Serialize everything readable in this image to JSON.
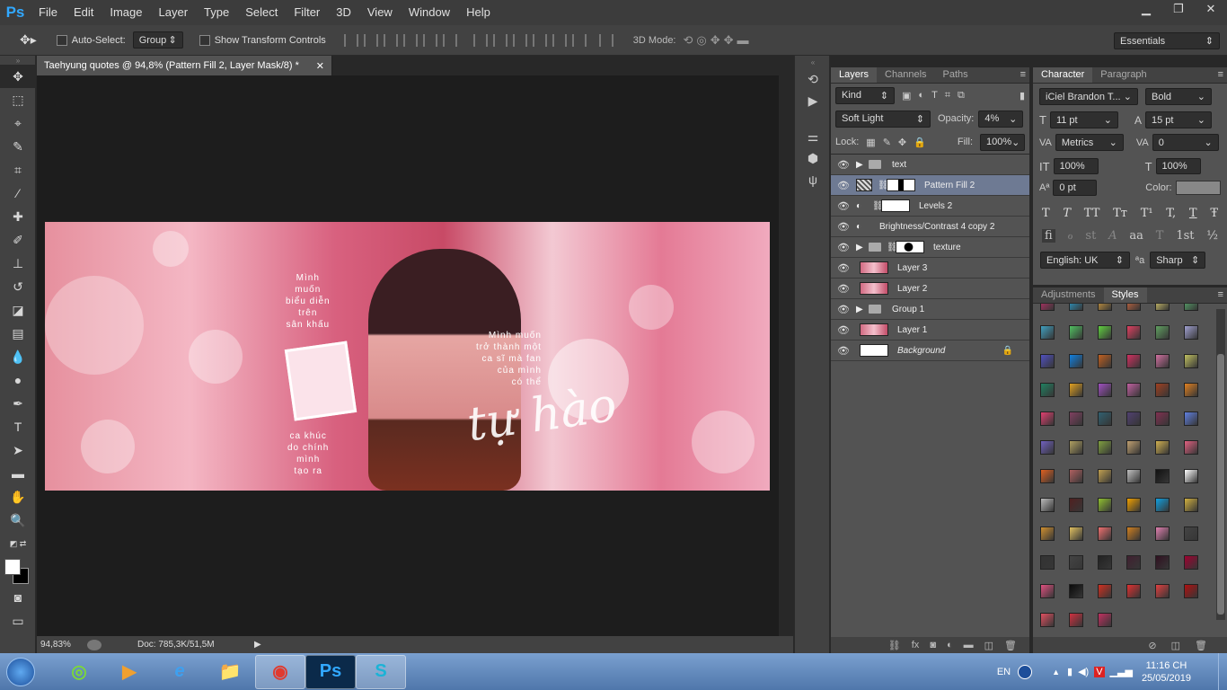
{
  "app": {
    "logo": "Ps"
  },
  "menu": [
    "File",
    "Edit",
    "Image",
    "Layer",
    "Type",
    "Select",
    "Filter",
    "3D",
    "View",
    "Window",
    "Help"
  ],
  "window_controls": {
    "minimize": "▁",
    "restore": "❐",
    "close": "✕"
  },
  "options": {
    "move_icon": "move-icon",
    "auto_select_label": "Auto-Select:",
    "auto_select_value": "Group",
    "show_transform_label": "Show Transform Controls",
    "mode_label": "3D Mode:",
    "workspace": "Essentials"
  },
  "document": {
    "tab_title": "Taehyung quotes @ 94,8% (Pattern Fill 2, Layer Mask/8) *",
    "close": "✕",
    "zoom": "94,83%",
    "doc_info": "Doc: 785,3K/51,5M"
  },
  "artwork": {
    "text_left_top": "Mình\nmuốn\nbiểu diễn\ntrên\nsân khấu",
    "text_left_bottom": "ca khúc\ndo chính\nmình\ntạo ra",
    "text_right": "Mình muốn\ntrở thành một\nca sĩ mà fan\ncủa mình\ncó thể",
    "script": "tự hào"
  },
  "layers_panel": {
    "tabs": [
      "Layers",
      "Channels",
      "Paths"
    ],
    "kind": "Kind",
    "blend": "Soft Light",
    "opacity_label": "Opacity:",
    "opacity": "4%",
    "lock_label": "Lock:",
    "fill_label": "Fill:",
    "fill": "100%",
    "layers": [
      {
        "name": "text",
        "type": "group"
      },
      {
        "name": "Pattern Fill 2",
        "type": "fill",
        "selected": true
      },
      {
        "name": "Levels 2",
        "type": "adjust"
      },
      {
        "name": "Brightness/Contrast 4 copy 2",
        "type": "adjust"
      },
      {
        "name": "texture",
        "type": "group"
      },
      {
        "name": "Layer 3",
        "type": "photo"
      },
      {
        "name": "Layer 2",
        "type": "photo"
      },
      {
        "name": "Group 1",
        "type": "group"
      },
      {
        "name": "Layer 1",
        "type": "photo"
      },
      {
        "name": "Background",
        "type": "background"
      }
    ]
  },
  "character_panel": {
    "tabs": [
      "Character",
      "Paragraph"
    ],
    "font": "iCiel Brandon T...",
    "style": "Bold",
    "size": "11 pt",
    "leading": "15 pt",
    "kerning": "Metrics",
    "tracking": "0",
    "vscale": "100%",
    "hscale": "100%",
    "baseline": "0 pt",
    "color_label": "Color:",
    "type_buttons": [
      "T",
      "T",
      "TT",
      "Tт",
      "T¹",
      "T,",
      "T",
      "Ŧ"
    ],
    "ot_buttons": [
      "fi",
      "ℴ",
      "st",
      "A",
      "aa",
      "T",
      "1st",
      "½"
    ],
    "language": "English: UK",
    "aa_icon": "ªa",
    "antialias": "Sharp"
  },
  "styles_panel": {
    "tabs": [
      "Adjustments",
      "Styles"
    ]
  },
  "taskbar": {
    "start_icon": "windows-start-icon",
    "apps": [
      "◎",
      "▶",
      "e",
      "📁",
      "◉",
      "Ps",
      "S"
    ],
    "lang": "EN",
    "time": "11:16 CH",
    "date": "25/05/2019"
  },
  "colors": {
    "accent": "#31a8ff",
    "panel": "#535353",
    "selection": "#6e7a93"
  }
}
